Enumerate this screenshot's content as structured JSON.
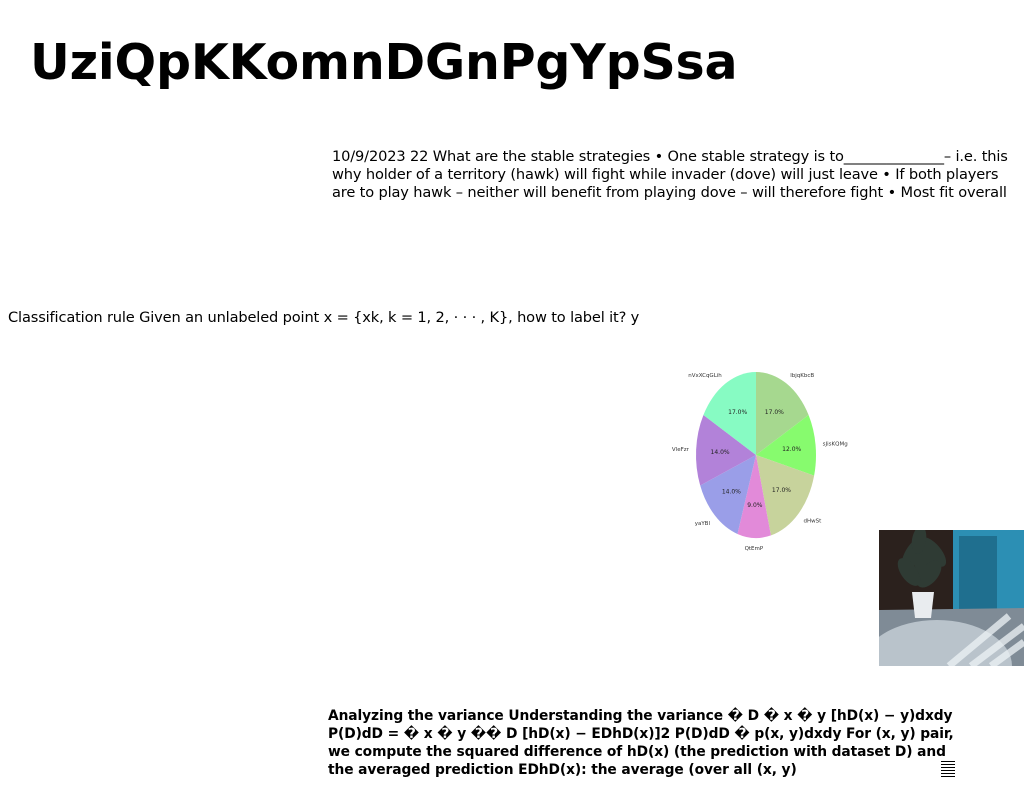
{
  "title": "UziQpKKomnDGnPgYpSsa",
  "paragraphs": {
    "stable_strategies": "10/9/2023 22 What are the stable strategies • One stable strategy is to______________– i.e. this why holder of a territory (hawk) will fight while invader (dove) will just leave • If both players are to play hawk – neither will benefit from playing dove – will therefore fight • Most fit overall is for",
    "classification_rule": "Classification rule Given an unlabeled point x = {xk, k = 1, 2, · · · , K}, how to label it? y",
    "variance": "Analyzing the variance Understanding the variance � D � x � y [hD(x) − y)dxdy P(D)dD = � x � y �� D [hD(x) − EDhD(x)]2 P(D)dD � p(x, y)dxdy For (x, y) pair, we compute the squared difference of hD(x) (the prediction with dataset D) and the averaged prediction EDhD(x): the average (over all (x, y)"
  },
  "chart_data": {
    "type": "pie",
    "start_angle_deg": 90,
    "direction": "clockwise",
    "labels": [
      "lbjqKbcB",
      "sJisKQMg",
      "dHwSt",
      "QtEmP",
      "yaYBl",
      "VleFzr",
      "nVxXCqGLih"
    ],
    "values": [
      17.0,
      12.0,
      17.0,
      9.0,
      14.0,
      14.0,
      17.0
    ],
    "value_labels": [
      "17.0%",
      "12.0%",
      "17.0%",
      "9.0%",
      "14.0%",
      "14.0%",
      "17.0%"
    ],
    "colors": [
      "#a6d88f",
      "#87fb6e",
      "#c7d39c",
      "#e28ad9",
      "#9a9ee8",
      "#b282d9",
      "#87fbc3"
    ]
  },
  "photo": {
    "colors": {
      "wall": "#2b211d",
      "door": "#2c8fb4",
      "door_dark": "#1f6f8f",
      "floor": "#7f8b96",
      "rug": "#b9c3cb",
      "pot": "#e9ecef",
      "leaf": "#2f3b34"
    }
  }
}
